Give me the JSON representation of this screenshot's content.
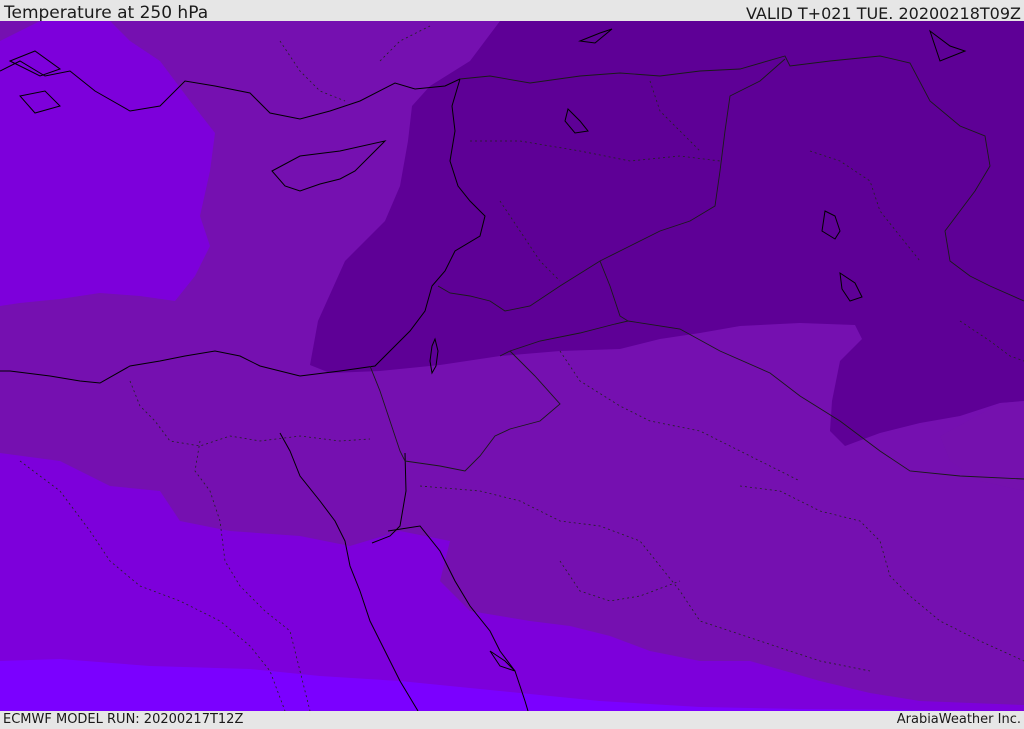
{
  "header": {
    "title": "Temperature at 250 hPa",
    "valid": "VALID T+021 TUE. 20200218T09Z"
  },
  "footer": {
    "model_run": "ECMWF MODEL RUN: 20200217T12Z",
    "credit": "ArabiaWeather Inc."
  },
  "map": {
    "field": "temperature",
    "level": "250 hPa",
    "colors": {
      "coldest": "#5e0096",
      "cold": "#7510b0",
      "mid": "#7d00db",
      "warm": "#7b00ff",
      "coastline": "#000000",
      "border": "#1a1a1a"
    }
  }
}
